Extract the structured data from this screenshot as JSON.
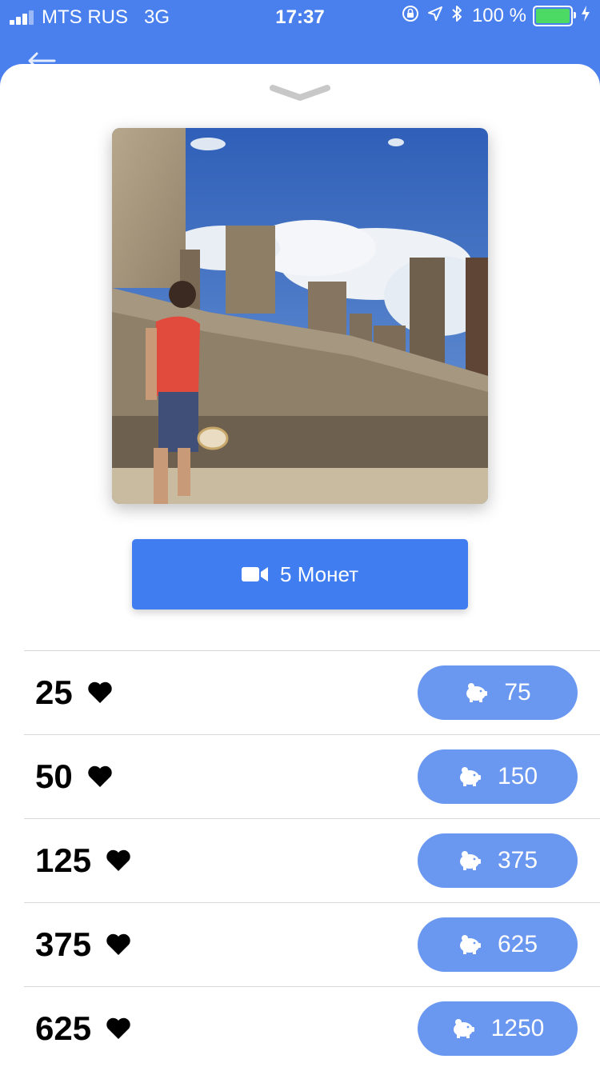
{
  "status_bar": {
    "carrier": "MTS RUS",
    "network": "3G",
    "time": "17:37",
    "battery": "100 %",
    "battery_color": "#4cd964"
  },
  "nav": {
    "back_icon": "back-arrow-icon"
  },
  "sheet": {
    "handle_icon": "chevron-down-icon",
    "photo": "photo of a man in a red shirt standing by ancient ruins",
    "watch_button": {
      "icon": "video-camera-icon",
      "label": "5 Монет"
    }
  },
  "offers": [
    {
      "likes": "25",
      "price": "75"
    },
    {
      "likes": "50",
      "price": "150"
    },
    {
      "likes": "125",
      "price": "375"
    },
    {
      "likes": "375",
      "price": "625"
    },
    {
      "likes": "625",
      "price": "1250"
    }
  ],
  "colors": {
    "header_bg": "#4a80ee",
    "primary_button": "#3f7df0",
    "price_button": "#6a97f0"
  }
}
